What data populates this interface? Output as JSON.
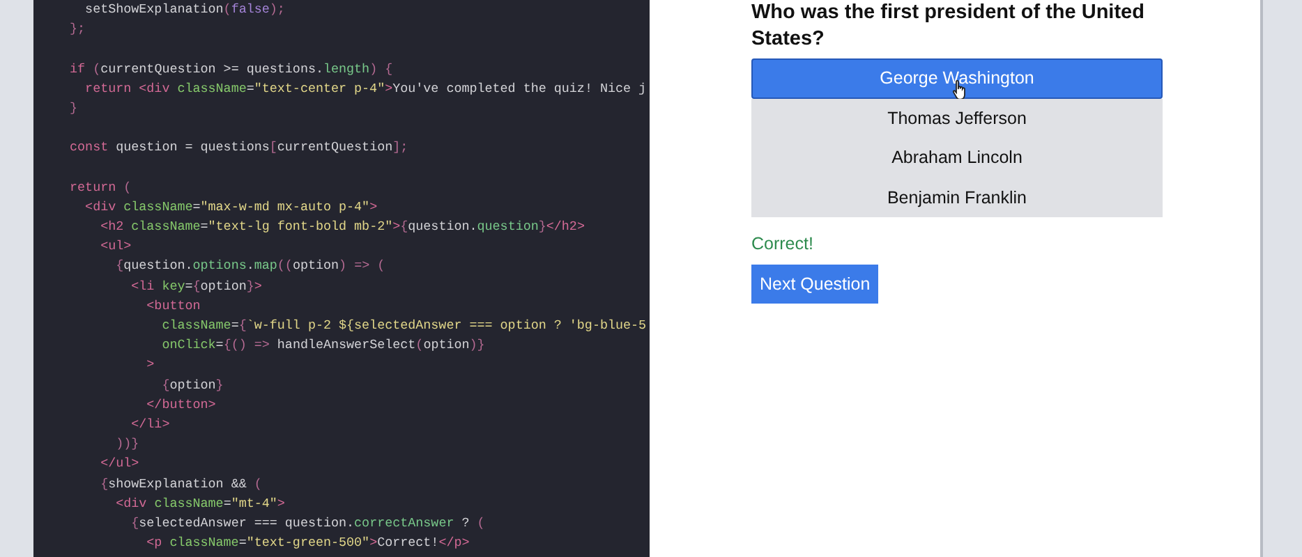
{
  "code_lines": [
    [
      {
        "kind": "t",
        "text": "    setShowExplanation"
      },
      {
        "kind": "b",
        "text": "("
      },
      {
        "kind": "n",
        "text": "false"
      },
      {
        "kind": "b",
        "text": ");"
      }
    ],
    [
      {
        "kind": "b",
        "text": "  };"
      }
    ],
    [
      {
        "kind": "k",
        "text": "  if "
      },
      {
        "kind": "b",
        "text": "("
      },
      {
        "kind": "t",
        "text": "currentQuestion >= questions."
      },
      {
        "kind": "p",
        "text": "length"
      },
      {
        "kind": "b",
        "text": ") {"
      }
    ],
    [
      {
        "kind": "k",
        "text": "    return <div "
      },
      {
        "kind": "a",
        "text": "className"
      },
      {
        "kind": "t",
        "text": "="
      },
      {
        "kind": "s",
        "text": "\"text-center p-4\""
      },
      {
        "kind": "k",
        "text": ">"
      },
      {
        "kind": "t",
        "text": "You've completed the quiz! Nice j"
      }
    ],
    [
      {
        "kind": "b",
        "text": "  }"
      }
    ],
    [
      {
        "kind": "k",
        "text": "  const "
      },
      {
        "kind": "t",
        "text": "question = questions"
      },
      {
        "kind": "b",
        "text": "["
      },
      {
        "kind": "t",
        "text": "currentQuestion"
      },
      {
        "kind": "b",
        "text": "];"
      }
    ],
    [
      {
        "kind": "k",
        "text": "  return "
      },
      {
        "kind": "b",
        "text": "("
      }
    ],
    [
      {
        "kind": "k",
        "text": "    <div "
      },
      {
        "kind": "a",
        "text": "className"
      },
      {
        "kind": "t",
        "text": "="
      },
      {
        "kind": "s",
        "text": "\"max-w-md mx-auto p-4\""
      },
      {
        "kind": "k",
        "text": ">"
      }
    ],
    [
      {
        "kind": "k",
        "text": "      <h2 "
      },
      {
        "kind": "a",
        "text": "className"
      },
      {
        "kind": "t",
        "text": "="
      },
      {
        "kind": "s",
        "text": "\"text-lg font-bold mb-2\""
      },
      {
        "kind": "k",
        "text": ">"
      },
      {
        "kind": "b",
        "text": "{"
      },
      {
        "kind": "t",
        "text": "question."
      },
      {
        "kind": "p",
        "text": "question"
      },
      {
        "kind": "b",
        "text": "}"
      },
      {
        "kind": "k",
        "text": "</h2>"
      }
    ],
    [
      {
        "kind": "k",
        "text": "      <ul>"
      }
    ],
    [
      {
        "kind": "b",
        "text": "        {"
      },
      {
        "kind": "t",
        "text": "question."
      },
      {
        "kind": "p",
        "text": "options"
      },
      {
        "kind": "t",
        "text": "."
      },
      {
        "kind": "p",
        "text": "map"
      },
      {
        "kind": "b",
        "text": "(("
      },
      {
        "kind": "t",
        "text": "option"
      },
      {
        "kind": "b",
        "text": ") => ("
      }
    ],
    [
      {
        "kind": "k",
        "text": "          <li "
      },
      {
        "kind": "a",
        "text": "key"
      },
      {
        "kind": "t",
        "text": "="
      },
      {
        "kind": "b",
        "text": "{"
      },
      {
        "kind": "t",
        "text": "option"
      },
      {
        "kind": "b",
        "text": "}"
      },
      {
        "kind": "k",
        "text": ">"
      }
    ],
    [
      {
        "kind": "k",
        "text": "            <button"
      }
    ],
    [
      {
        "kind": "a",
        "text": "              className"
      },
      {
        "kind": "t",
        "text": "="
      },
      {
        "kind": "b",
        "text": "{"
      },
      {
        "kind": "s",
        "text": "`w-full p-2 ${selectedAnswer === option ? 'bg-blue-5"
      }
    ],
    [
      {
        "kind": "a",
        "text": "              onClick"
      },
      {
        "kind": "t",
        "text": "="
      },
      {
        "kind": "b",
        "text": "{() => "
      },
      {
        "kind": "t",
        "text": "handleAnswerSelect"
      },
      {
        "kind": "b",
        "text": "("
      },
      {
        "kind": "t",
        "text": "option"
      },
      {
        "kind": "b",
        "text": ")}"
      }
    ],
    [
      {
        "kind": "k",
        "text": "            >"
      }
    ],
    [
      {
        "kind": "b",
        "text": "              {"
      },
      {
        "kind": "t",
        "text": "option"
      },
      {
        "kind": "b",
        "text": "}"
      }
    ],
    [
      {
        "kind": "k",
        "text": "            </button>"
      }
    ],
    [
      {
        "kind": "k",
        "text": "          </li>"
      }
    ],
    [
      {
        "kind": "b",
        "text": "        ))}"
      }
    ],
    [
      {
        "kind": "k",
        "text": "      </ul>"
      }
    ],
    [
      {
        "kind": "b",
        "text": "      {"
      },
      {
        "kind": "t",
        "text": "showExplanation && "
      },
      {
        "kind": "b",
        "text": "("
      }
    ],
    [
      {
        "kind": "k",
        "text": "        <div "
      },
      {
        "kind": "a",
        "text": "className"
      },
      {
        "kind": "t",
        "text": "="
      },
      {
        "kind": "s",
        "text": "\"mt-4\""
      },
      {
        "kind": "k",
        "text": ">"
      }
    ],
    [
      {
        "kind": "b",
        "text": "          {"
      },
      {
        "kind": "t",
        "text": "selectedAnswer === question."
      },
      {
        "kind": "p",
        "text": "correctAnswer"
      },
      {
        "kind": "t",
        "text": " ? "
      },
      {
        "kind": "b",
        "text": "("
      }
    ],
    [
      {
        "kind": "k",
        "text": "            <p "
      },
      {
        "kind": "a",
        "text": "className"
      },
      {
        "kind": "t",
        "text": "="
      },
      {
        "kind": "s",
        "text": "\"text-green-500\""
      },
      {
        "kind": "k",
        "text": ">"
      },
      {
        "kind": "t",
        "text": "Correct!"
      },
      {
        "kind": "k",
        "text": "</p>"
      }
    ]
  ],
  "quiz": {
    "question": "Who was the first president of the United States?",
    "options": [
      {
        "label": "George Washington",
        "selected": true
      },
      {
        "label": "Thomas Jefferson",
        "selected": false
      },
      {
        "label": "Abraham Lincoln",
        "selected": false
      },
      {
        "label": "Benjamin Franklin",
        "selected": false
      }
    ],
    "feedback": {
      "kind": "correct",
      "text": "Correct!"
    },
    "next_button": "Next Question"
  }
}
